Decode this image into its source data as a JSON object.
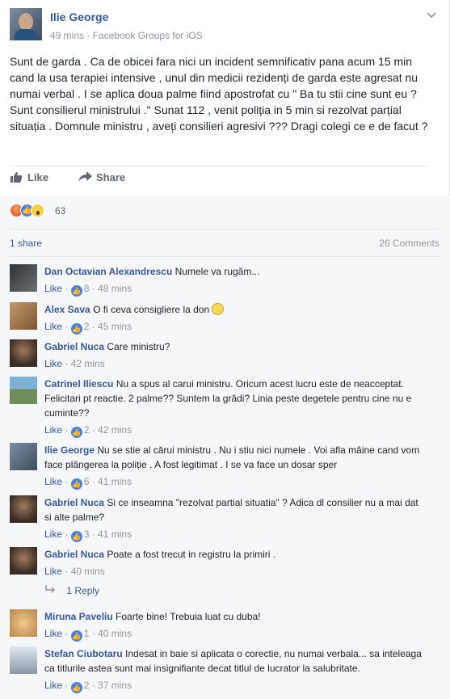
{
  "post": {
    "author": "Ilie George",
    "meta": "49 mins · Facebook Groups for iOS",
    "text": "Sunt de garda . Ca de obicei fara nici un incident semnificativ pana acum 15 min cand la usa terapiei intensive , unul din medicii rezidenți de garda este agresat nu numai verbal . I se aplica doua palme fiind apostrofat cu \" Ba tu stii cine sunt eu ? Sunt consilierul ministrului .\" Sunat 112 , venit poliția in 5 min si rezolvat parțial situația . Domnule ministru , aveți consilieri agresivi ??? Dragi colegi ce e de facut ?"
  },
  "actions": {
    "like": "Like",
    "share": "Share"
  },
  "reactions": {
    "count": "63"
  },
  "summary": {
    "shares": "1 share",
    "comments": "26 Comments"
  },
  "comments": [
    {
      "name": "Dan Octavian Alexandrescu",
      "text": "Numele va rugăm...",
      "like": "Like",
      "likes": "8",
      "time": "48 mins"
    },
    {
      "name": "Alex Sava",
      "text": "O fi ceva consigliere la don",
      "like": "Like",
      "likes": "2",
      "time": "45 mins"
    },
    {
      "name": "Gabriel Nuca",
      "text": "Care ministru?",
      "like": "Like",
      "likes": "",
      "time": "42 mins"
    },
    {
      "name": "Catrinel Iliescu",
      "text": "Nu a spus al carui ministru. Oricum acest lucru este de neacceptat. Felicitari pt reactie. 2 palme?? Suntem la grădi? Linia peste degetele pentru cine nu e cuminte??",
      "like": "Like",
      "likes": "2",
      "time": "42 mins"
    },
    {
      "name": "Ilie George",
      "text": "Nu se stie al cărui ministru . Nu i stiu nici numele . Voi afla mâine cand vom face plângerea la poliție . A fost legitimat . I se va face un dosar sper",
      "like": "Like",
      "likes": "6",
      "time": "41 mins"
    },
    {
      "name": "Gabriel Nuca",
      "text": "Si ce inseamna \"rezolvat partial situatia\" ? Adica dl consilier nu a mai dat si alte palme?",
      "like": "Like",
      "likes": "3",
      "time": "41 mins"
    },
    {
      "name": "Gabriel Nuca",
      "text": "Poate a fost trecut in registru la primiri .",
      "like": "Like",
      "likes": "",
      "time": "40 mins"
    },
    {
      "name": "Miruna Paveliu",
      "text": "Foarte bine! Trebuia luat cu duba!",
      "like": "Like",
      "likes": "1",
      "time": "40 mins"
    },
    {
      "name": "Stefan Ciubotaru",
      "text": "Indesat in baie si aplicata o corectie, nu numai verbala... sa inteleaga ca titlurile astea sunt mai insignifiante decat titlul de lucrator la salubritate.",
      "like": "Like",
      "likes": "2",
      "time": "37 mins"
    }
  ],
  "reply": {
    "label": "1 Reply"
  },
  "colors": {
    "link": "#365899",
    "meta": "#90949c",
    "like_blue": "#4b7fe8"
  }
}
